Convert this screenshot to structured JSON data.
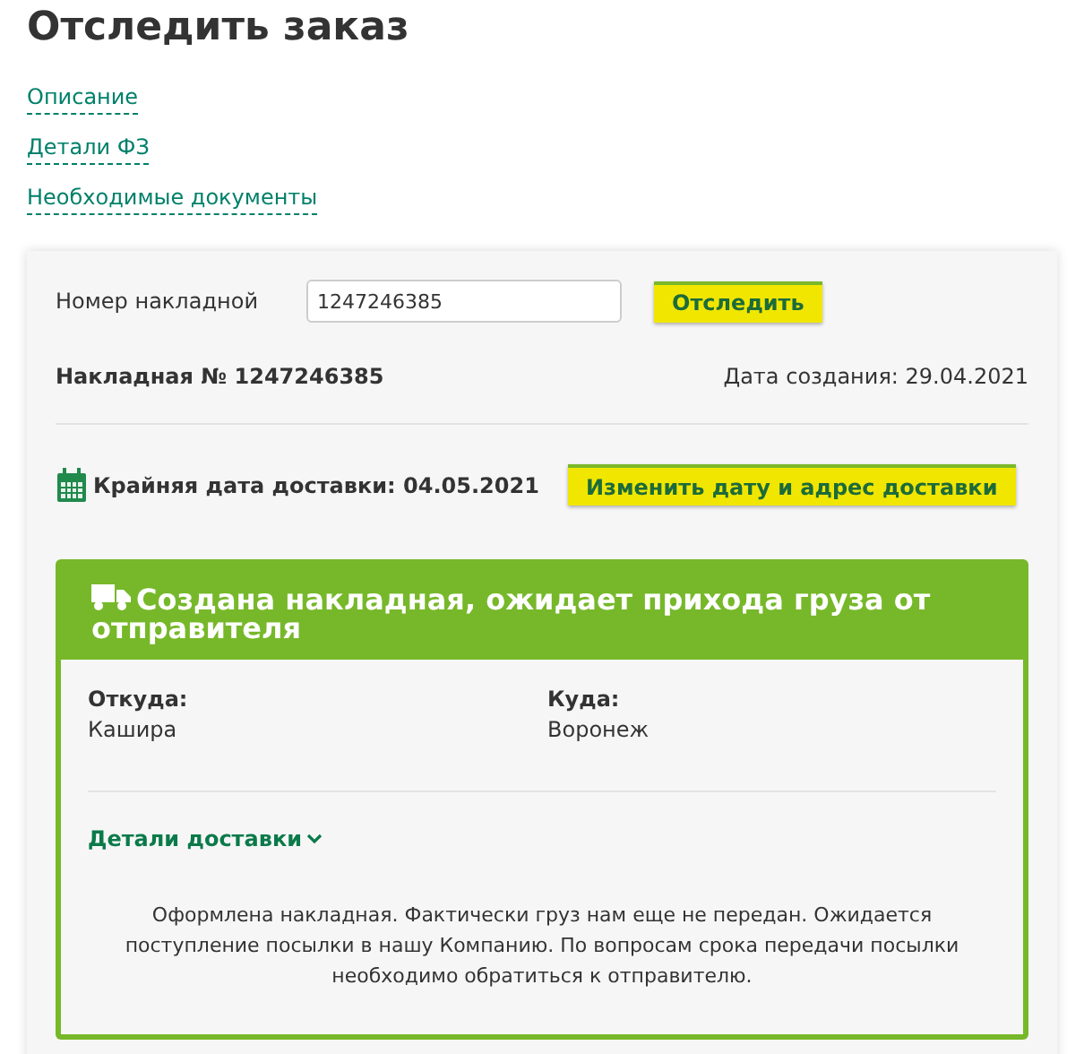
{
  "page_title": "Отследить заказ",
  "links": [
    "Описание",
    "Детали ФЗ",
    "Необходимые документы"
  ],
  "search": {
    "label": "Номер накладной",
    "value": "1247246385",
    "button": "Отследить"
  },
  "waybill": {
    "number": "Накладная № 1247246385",
    "created": "Дата создания: 29.04.2021"
  },
  "deadline": {
    "text": "Крайняя дата доставки: 04.05.2021",
    "button": "Изменить дату и адрес доставки"
  },
  "status": {
    "title": "Создана накладная, ожидает прихода груза от отправителя",
    "from": {
      "label": "Откуда:",
      "value": "Кашира"
    },
    "to": {
      "label": "Куда:",
      "value": "Воронеж"
    },
    "details_link": "Детали доставки",
    "message": "Оформлена накладная. Фактически груз нам еще не передан. Ожидается поступление посылки в нашу Компанию. По вопросам срока передачи посылки необходимо обратиться к отправителю."
  }
}
